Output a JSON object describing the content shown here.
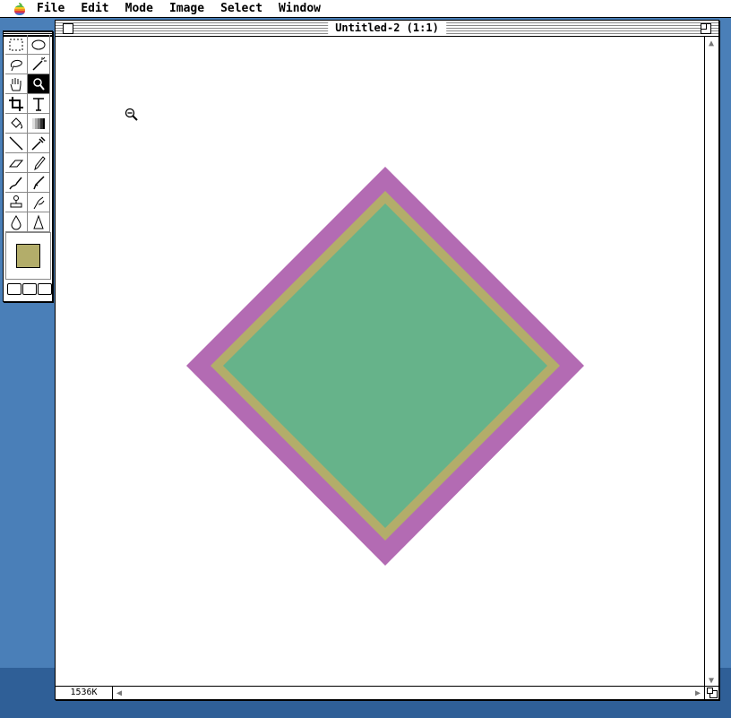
{
  "menubar": {
    "items": [
      "File",
      "Edit",
      "Mode",
      "Image",
      "Select",
      "Window"
    ]
  },
  "toolbox": {
    "tools": [
      {
        "name": "marquee-rect-icon"
      },
      {
        "name": "marquee-ellipse-icon"
      },
      {
        "name": "lasso-icon"
      },
      {
        "name": "magic-wand-icon"
      },
      {
        "name": "hand-icon"
      },
      {
        "name": "zoom-icon",
        "active": true
      },
      {
        "name": "crop-icon"
      },
      {
        "name": "text-icon"
      },
      {
        "name": "paint-bucket-icon"
      },
      {
        "name": "gradient-icon"
      },
      {
        "name": "line-icon"
      },
      {
        "name": "eyedropper-icon"
      },
      {
        "name": "eraser-icon"
      },
      {
        "name": "pencil-icon"
      },
      {
        "name": "airbrush-icon"
      },
      {
        "name": "paintbrush-icon"
      },
      {
        "name": "rubber-stamp-icon"
      },
      {
        "name": "smudge-icon"
      },
      {
        "name": "blur-icon"
      },
      {
        "name": "sharpen-icon"
      }
    ],
    "foreground_color": "#b3ad6a"
  },
  "document": {
    "title": "Untitled-2 (1:1)",
    "size_label": "1536K"
  },
  "artwork": {
    "outer_color": "#b36bb3",
    "border_color": "#b3ad6a",
    "inner_color": "#66b38a"
  }
}
